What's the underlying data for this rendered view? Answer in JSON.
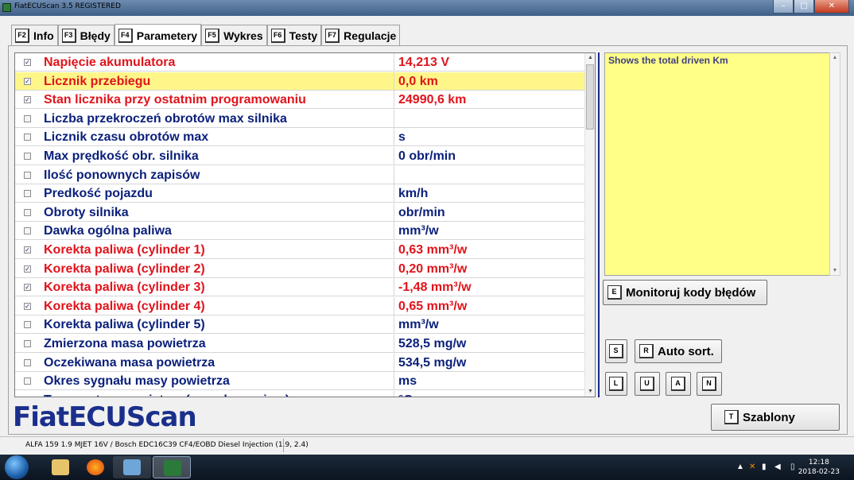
{
  "window": {
    "title": "FiatECUScan 3.5 REGISTERED",
    "controls": [
      "–",
      "□",
      "✕"
    ]
  },
  "tabs": [
    {
      "key": "F2",
      "label": "Info",
      "active": false
    },
    {
      "key": "F3",
      "label": "Błędy",
      "active": false
    },
    {
      "key": "F4",
      "label": "Parametery",
      "active": true
    },
    {
      "key": "F5",
      "label": "Wykres",
      "active": false
    },
    {
      "key": "F6",
      "label": "Testy",
      "active": false
    },
    {
      "key": "F7",
      "label": "Regulacje",
      "active": false
    }
  ],
  "parameters": [
    {
      "checked": true,
      "name": "Napięcie akumulatora",
      "value": "14,213 V",
      "color": "red"
    },
    {
      "checked": true,
      "name": "Licznik przebiegu",
      "value": "0,0 km",
      "color": "red",
      "selected": true
    },
    {
      "checked": true,
      "name": "Stan licznika przy ostatnim programowaniu",
      "value": "24990,6 km",
      "color": "red"
    },
    {
      "checked": false,
      "name": "Liczba przekroczeń obrotów max silnika",
      "value": "",
      "color": "blue"
    },
    {
      "checked": false,
      "name": "Licznik czasu obrotów max",
      "value": " s",
      "color": "blue"
    },
    {
      "checked": false,
      "name": "Max prędkość obr. silnika",
      "value": "0 obr/min",
      "color": "blue"
    },
    {
      "checked": false,
      "name": "Ilość ponownych zapisów",
      "value": "",
      "color": "blue"
    },
    {
      "checked": false,
      "name": "Predkość pojazdu",
      "value": " km/h",
      "color": "blue"
    },
    {
      "checked": false,
      "name": "Obroty silnika",
      "value": " obr/min",
      "color": "blue"
    },
    {
      "checked": false,
      "name": "Dawka ogólna paliwa",
      "value": " mm³/w",
      "color": "blue"
    },
    {
      "checked": true,
      "name": "Korekta paliwa (cylinder 1)",
      "value": "0,63 mm³/w",
      "color": "red"
    },
    {
      "checked": true,
      "name": "Korekta paliwa (cylinder 2)",
      "value": "0,20 mm³/w",
      "color": "red"
    },
    {
      "checked": true,
      "name": "Korekta paliwa (cylinder 3)",
      "value": "-1,48 mm³/w",
      "color": "red"
    },
    {
      "checked": true,
      "name": "Korekta paliwa (cylinder 4)",
      "value": "0,65 mm³/w",
      "color": "red"
    },
    {
      "checked": false,
      "name": "Korekta paliwa (cylinder 5)",
      "value": " mm³/w",
      "color": "blue"
    },
    {
      "checked": false,
      "name": "Zmierzona masa powietrza",
      "value": "528,5 mg/w",
      "color": "blue"
    },
    {
      "checked": false,
      "name": "Oczekiwana masa powietrza",
      "value": "534,5 mg/w",
      "color": "blue"
    },
    {
      "checked": false,
      "name": "Okres sygnału masy powietrza",
      "value": " ms",
      "color": "blue"
    },
    {
      "checked": false,
      "name": "Temperatura powietrza (przepływomierz)",
      "value": " °C",
      "color": "blue"
    }
  ],
  "description": {
    "text": "Shows the total driven Km"
  },
  "buttons": {
    "monitor": {
      "key": "E",
      "label": "Monitoruj kody błędów"
    },
    "s": {
      "key": "S"
    },
    "autosort": {
      "key": "R",
      "label": "Auto sort."
    },
    "l": {
      "key": "L"
    },
    "u": {
      "key": "U"
    },
    "a": {
      "key": "A"
    },
    "n": {
      "key": "N"
    },
    "templates": {
      "key": "T",
      "label": "Szablony"
    }
  },
  "logo": {
    "text": "FiatECUScan"
  },
  "status": {
    "text": "ALFA 159 1.9 MJET 16V / Bosch EDC16C39 CF4/EOBD Diesel Injection (1.9, 2.4)"
  },
  "taskbar": {
    "time": "12:18",
    "date": "2018-02-23"
  },
  "colors": {
    "red": "#e0141c",
    "blue": "#0a1f7a",
    "highlight": "#fff68a",
    "desc_bg": "#ffff88",
    "logo": "#1a2f8c"
  }
}
